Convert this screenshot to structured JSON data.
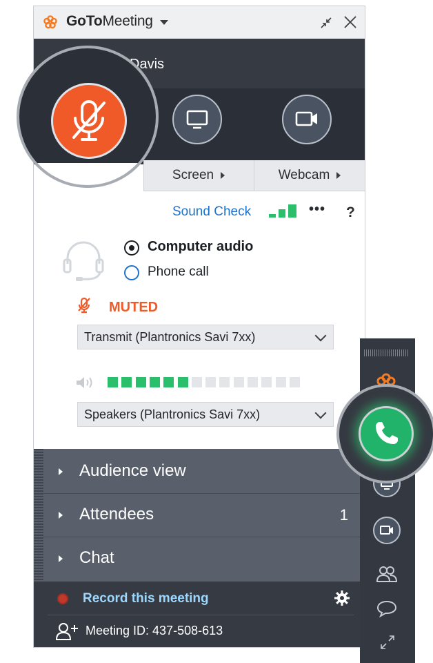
{
  "window": {
    "app_title_bold": "GoTo",
    "app_title_rest": "Meeting",
    "user_name_fragment": "Davis"
  },
  "controls": {
    "mute_state": "muted",
    "screen_label": "Screen",
    "webcam_label": "Webcam"
  },
  "audio": {
    "sound_check": "Sound Check",
    "more": "•••",
    "help": "?",
    "options": [
      "Computer audio",
      "Phone call"
    ],
    "selected_option": "Computer audio",
    "mute_status": "MUTED",
    "microphone": "Transmit (Plantronics Savi 7xx)",
    "speakers": "Speakers (Plantronics Savi 7xx)",
    "speaker_level": {
      "lit": 6,
      "total": 14
    },
    "signal_bars": 3
  },
  "sections": {
    "audience": "Audience view",
    "attendees": "Attendees",
    "attendees_count": "1",
    "chat": "Chat"
  },
  "footer": {
    "record": "Record this meeting",
    "meeting_id": "Meeting ID: 437-508-613"
  },
  "colors": {
    "accent_orange": "#f05a28",
    "call_green": "#22b36a",
    "link_blue": "#1f72c9",
    "dark_panel": "#363b43"
  },
  "icons": [
    "gotomeeting-logo-icon",
    "chevron-down-icon",
    "collapse-icon",
    "close-icon",
    "mic-muted-icon",
    "screen-icon",
    "webcam-icon",
    "headset-icon",
    "speaker-icon",
    "gear-icon",
    "add-user-icon",
    "phone-icon",
    "attendees-icon",
    "chat-icon",
    "expand-icon"
  ]
}
